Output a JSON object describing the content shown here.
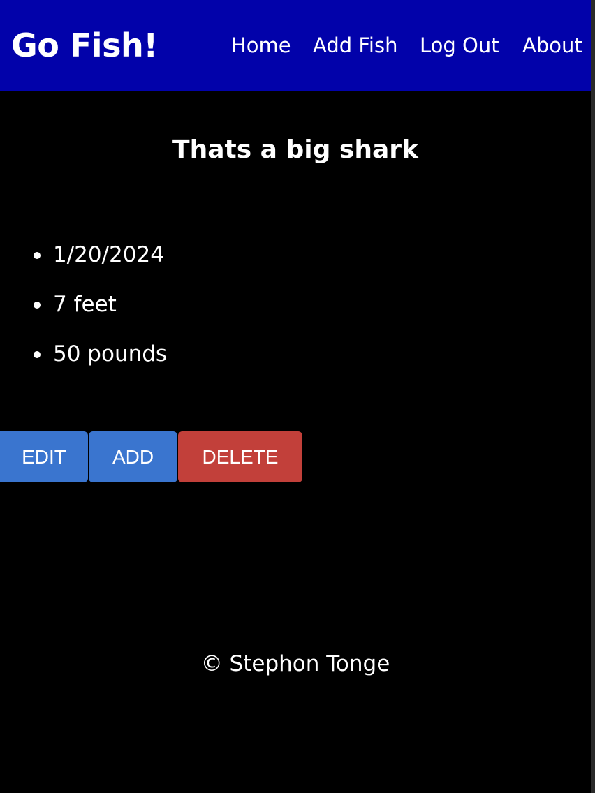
{
  "header": {
    "brand": "Go Fish!",
    "nav": [
      "Home",
      "Add Fish",
      "Log Out",
      "About"
    ]
  },
  "main": {
    "title": "Thats a big shark",
    "details": [
      "1/20/2024",
      "7 feet",
      "50 pounds"
    ],
    "buttons": {
      "edit": "EDIT",
      "add": "ADD",
      "delete": "DELETE"
    }
  },
  "footer": {
    "text": "© Stephon Tonge"
  },
  "colors": {
    "header_bg": "#0202aa",
    "page_bg": "#000000",
    "text": "#ffffff",
    "primary_button": "#3a75cf",
    "danger_button": "#c2403a"
  }
}
